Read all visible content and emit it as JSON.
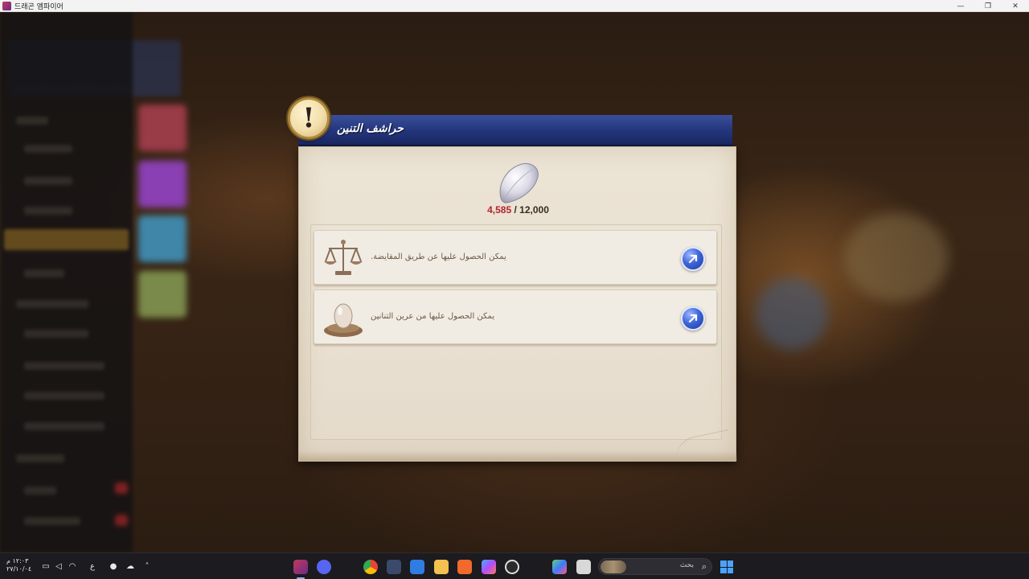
{
  "window": {
    "title": "드래곤 엠파이어",
    "controls": [
      "—",
      "❐",
      "✕"
    ]
  },
  "dialog": {
    "title": "حراشف التنين",
    "warning_icon": "!",
    "counter": {
      "current": "4,585",
      "separator": " / ",
      "max": "12,000"
    },
    "sources": [
      {
        "icon": "scales-icon",
        "text": "يمكن الحصول عليها عن طريق المقايضة."
      },
      {
        "icon": "dragon-egg-nest-icon",
        "text": "يمكن الحصول عليها من عرين التنانين"
      }
    ]
  },
  "taskbar": {
    "time": "١٢:٠٣ م",
    "date": "٢٧/١٠/٠٤",
    "language": "ع",
    "search_placeholder": "بحث"
  }
}
